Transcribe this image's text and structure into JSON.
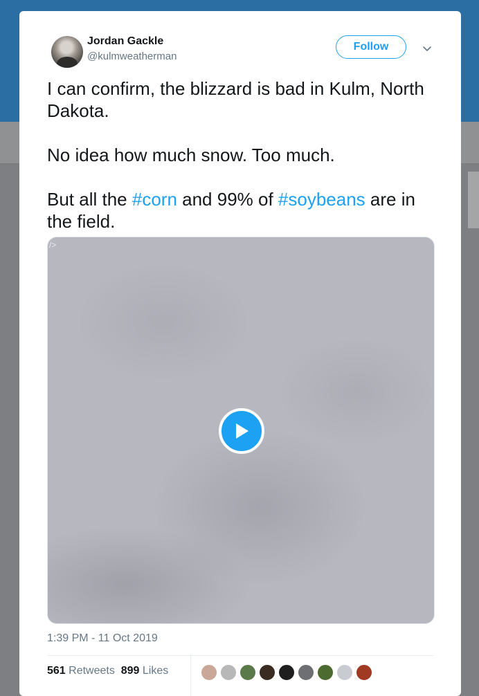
{
  "tweet": {
    "author_name": "Jordan Gackle",
    "author_handle": "@kulmweatherman",
    "follow_label": "Follow",
    "text_line1": "I can confirm, the blizzard is bad in Kulm, North Dakota.",
    "text_line2": "No idea how much snow. Too much.",
    "text_line3_pre": "But all the ",
    "hashtag_corn": "#corn",
    "text_line3_mid": " and 99% of ",
    "hashtag_soybeans": "#soybeans",
    "text_line3_post": " are in the field.",
    "media_tag": "/>",
    "timestamp": "1:39 PM - 11 Oct 2019",
    "retweets_count": "561",
    "retweets_label": "Retweets",
    "likes_count": "899",
    "likes_label": "Likes"
  },
  "colors": {
    "accent": "#1da1f2",
    "text_primary": "#14171a",
    "text_secondary": "#657786",
    "header_bg": "#2a6ea3"
  },
  "icons": {
    "caret": "chevron-down-icon",
    "play": "play-icon"
  },
  "likers": [
    {
      "color": "#c9a89a"
    },
    {
      "color": "#b8b8b8"
    },
    {
      "color": "#5b7a4a"
    },
    {
      "color": "#3a2c22"
    },
    {
      "color": "#1f1f1f"
    },
    {
      "color": "#6d6f72"
    },
    {
      "color": "#4c6b2e"
    },
    {
      "color": "#c8ccd2"
    },
    {
      "color": "#a03a22"
    }
  ]
}
